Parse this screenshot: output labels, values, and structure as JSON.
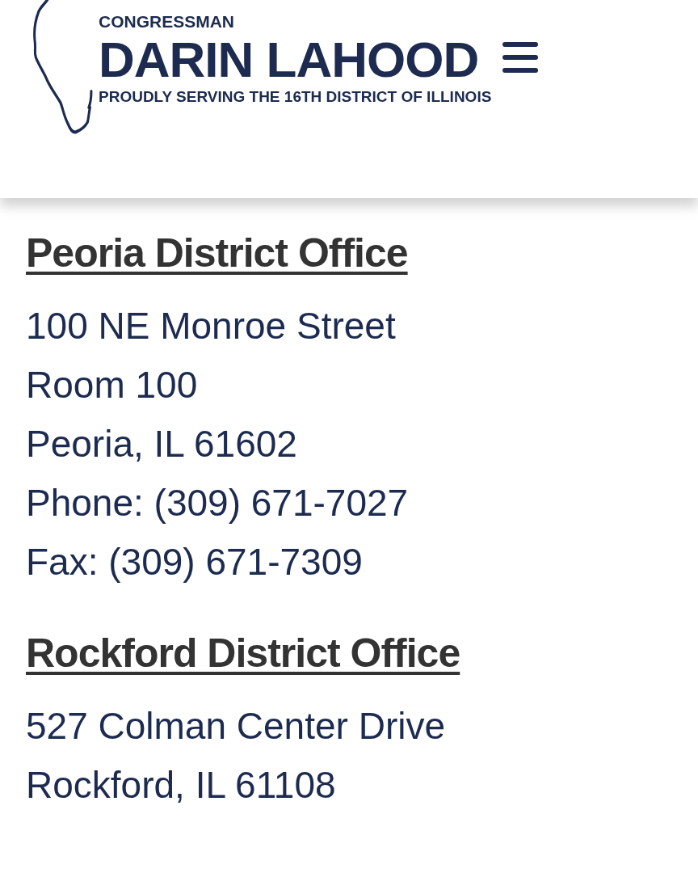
{
  "header": {
    "logo": {
      "eyebrow": "CONGRESSMAN",
      "name": "DARIN LAHOOD",
      "tagline": "PROUDLY SERVING THE 16TH DISTRICT OF ILLINOIS"
    }
  },
  "offices": [
    {
      "title": "Peoria District Office",
      "lines": [
        "100 NE Monroe Street",
        "Room 100",
        "Peoria, IL 61602",
        "Phone: (309) 671-7027",
        "Fax: (309) 671-7309"
      ]
    },
    {
      "title": "Rockford District Office",
      "lines": [
        "527 Colman Center Drive",
        "Rockford, IL 61108"
      ]
    }
  ]
}
